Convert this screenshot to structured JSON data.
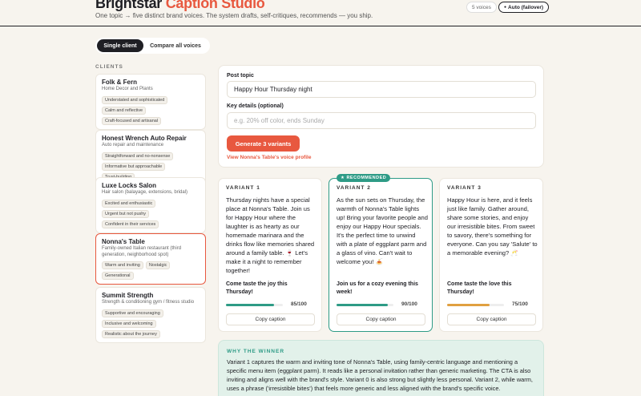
{
  "header": {
    "brand_main": "Brightstar",
    "brand_accent": "Caption Studio",
    "tagline": "One topic → five distinct brand voices. The system drafts, self-critiques, recommends — you ship.",
    "voices_pill": "5 voices",
    "mode_pill": "Auto (failover)"
  },
  "tabs": {
    "single": "Single client",
    "compare": "Compare all voices"
  },
  "clients_label": "CLIENTS",
  "clients": [
    {
      "name": "Folk & Fern",
      "desc": "Home Decor and Plants",
      "tags": [
        "Understated and sophisticated",
        "Calm and reflective",
        "Craft-focused and artisanal"
      ]
    },
    {
      "name": "Honest Wrench Auto Repair",
      "desc": "Auto repair and maintenance",
      "tags": [
        "Straightforward and no-nonsense",
        "Informative but approachable",
        "Trust-building"
      ]
    },
    {
      "name": "Luxe Locks Salon",
      "desc": "Hair salon (balayage, extensions, bridal)",
      "tags": [
        "Excited and enthusiastic",
        "Urgent but not pushy",
        "Confident in their services"
      ]
    },
    {
      "name": "Nonna's Table",
      "desc": "Family-owned Italian restaurant (third generation, neighborhood spot)",
      "tags": [
        "Warm and inviting",
        "Nostalgic",
        "Generational"
      ]
    },
    {
      "name": "Summit Strength",
      "desc": "Strength & conditioning gym / fitness studio",
      "tags": [
        "Supportive and encouraging",
        "Inclusive and welcoming",
        "Realistic about the journey"
      ]
    }
  ],
  "form": {
    "topic_label": "Post topic",
    "topic_value": "Happy Hour Thursday night",
    "details_label": "Key details (optional)",
    "details_placeholder": "e.g. 20% off color, ends Sunday",
    "generate_label": "Generate 3 variants",
    "profile_link": "View Nonna's Table's voice profile"
  },
  "recommended_badge": "RECOMMENDED",
  "variants": [
    {
      "label": "VARIANT 1",
      "body": "Thursday nights have a special place at Nonna's Table. Join us for Happy Hour where the laughter is as hearty as our homemade marinara and the drinks flow like memories shared around a family table. 🍷 Let's make it a night to remember together!",
      "cta": "Come taste the joy this Thursday!",
      "score": 85,
      "score_text": "85/100",
      "bar_color": "#2e9b86",
      "copy": "Copy caption"
    },
    {
      "label": "VARIANT 2",
      "body": "As the sun sets on Thursday, the warmth of Nonna's Table lights up! Bring your favorite people and enjoy our Happy Hour specials. It's the perfect time to unwind with a plate of eggplant parm and a glass of vino. Can't wait to welcome you! 🍝",
      "cta": "Join us for a cozy evening this week!",
      "score": 90,
      "score_text": "90/100",
      "bar_color": "#2e9b86",
      "copy": "Copy caption"
    },
    {
      "label": "VARIANT 3",
      "body": "Happy Hour is here, and it feels just like family. Gather around, share some stories, and enjoy our irresistible bites. From sweet to savory, there's something for everyone. Can you say 'Salute' to a memorable evening? 🥂",
      "cta": "Come taste the love this Thursday!",
      "score": 75,
      "score_text": "75/100",
      "bar_color": "#e0a040",
      "copy": "Copy caption"
    }
  ],
  "winner": {
    "label": "WHY THE WINNER",
    "text": "Variant 1 captures the warm and inviting tone of Nonna's Table, using family-centric language and mentioning a specific menu item (eggplant parm). It reads like a personal invitation rather than generic marketing. The CTA is also inviting and aligns well with the brand's style. Variant 0 is also strong but slightly less personal. Variant 2, while warm, uses a phrase ('irresistible bites') that feels more generic and less aligned with the brand's specific voice."
  }
}
